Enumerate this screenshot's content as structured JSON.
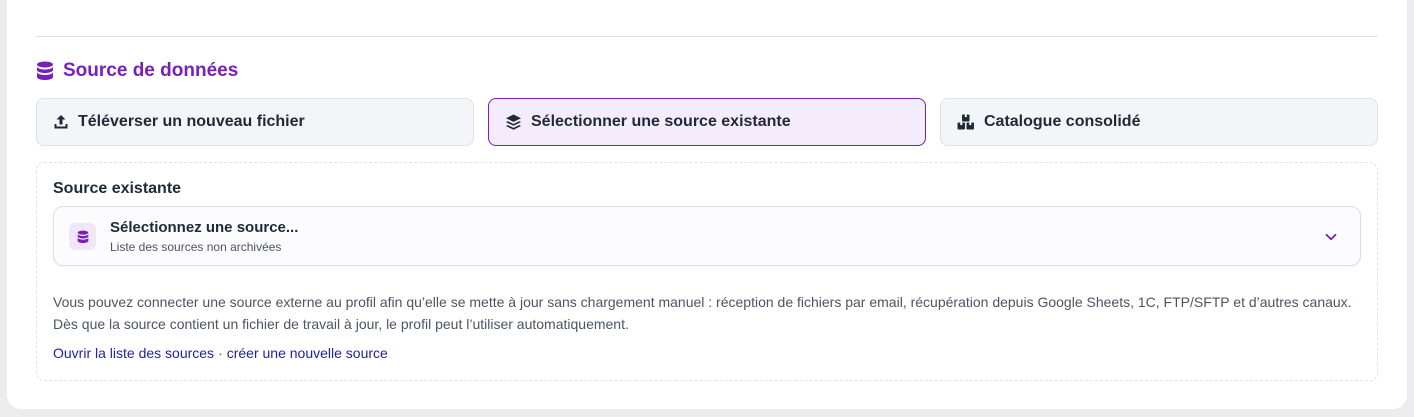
{
  "section": {
    "title": "Source de données",
    "icon": "database-icon",
    "accent_color": "#7a1fb8"
  },
  "tabs": [
    {
      "label": "Téléverser un nouveau fichier",
      "icon": "upload-icon",
      "active": false
    },
    {
      "label": "Sélectionner une source existante",
      "icon": "layers-icon",
      "active": true
    },
    {
      "label": "Catalogue consolidé",
      "icon": "boxes-icon",
      "active": false
    }
  ],
  "panel": {
    "label": "Source existante",
    "select": {
      "placeholder": "Sélectionnez une source...",
      "subtitle": "Liste des sources non archivées",
      "icon": "database-icon"
    },
    "help_text": "Vous pouvez connecter une source externe au profil afin qu’elle se mette à jour sans chargement manuel : réception de fichiers par email, récupération depuis Google Sheets, 1C, FTP/SFTP et d’autres canaux. Dès que la source contient un fichier de travail à jour, le profil peut l’utiliser automatiquement.",
    "links": {
      "open_sources": "Ouvrir la liste des sources",
      "separator": "·",
      "create_source": "créer une nouvelle source"
    }
  }
}
